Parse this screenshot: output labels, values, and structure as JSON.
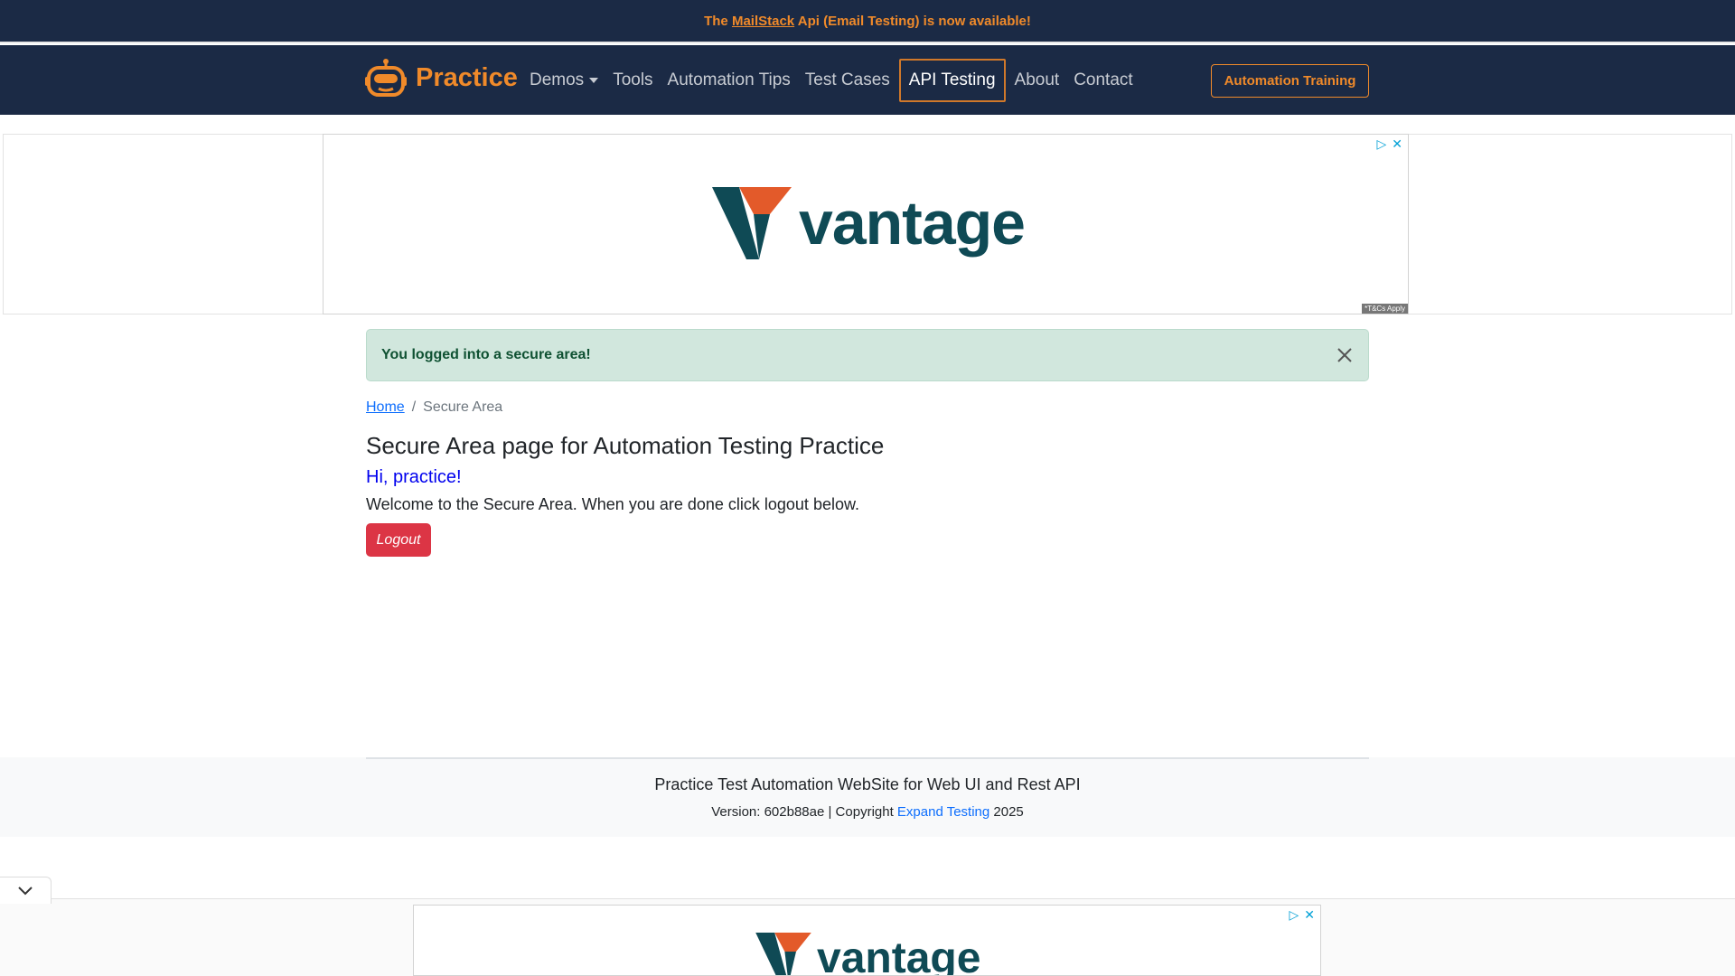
{
  "announcement": {
    "prefix": "The ",
    "link": "MailStack",
    "suffix": " Api (Email Testing) is now available!"
  },
  "brand": {
    "name": "Practice"
  },
  "nav": {
    "items": [
      {
        "label": "Demos",
        "dropdown": true
      },
      {
        "label": "Tools"
      },
      {
        "label": "Automation Tips"
      },
      {
        "label": "Test Cases"
      },
      {
        "label": "API Testing",
        "active": true
      },
      {
        "label": "About"
      },
      {
        "label": "Contact"
      }
    ],
    "cta": "Automation Training"
  },
  "ad": {
    "brand": "vantage",
    "tc": "*T&Cs Apply",
    "choices_icon": "adchoices-icon",
    "close_icon": "close-icon"
  },
  "alert": {
    "message": "You logged into a secure area!"
  },
  "breadcrumb": {
    "home": "Home",
    "separator": "/",
    "current": "Secure Area"
  },
  "main": {
    "title": "Secure Area page for Automation Testing Practice",
    "greeting": "Hi, practice!",
    "welcome": "Welcome to the Secure Area. When you are done click logout below.",
    "logout_label": "Logout"
  },
  "footer": {
    "title": "Practice Test Automation WebSite for Web UI and Rest API",
    "version_prefix": "Version: 602b88ae | Copyright ",
    "link": "Expand Testing",
    "year": " 2025"
  },
  "colors": {
    "navy": "#1b2a45",
    "orange": "#f08a2a",
    "danger": "#dc3545",
    "success_bg": "#d1e7dd",
    "link": "#0d6efd"
  }
}
